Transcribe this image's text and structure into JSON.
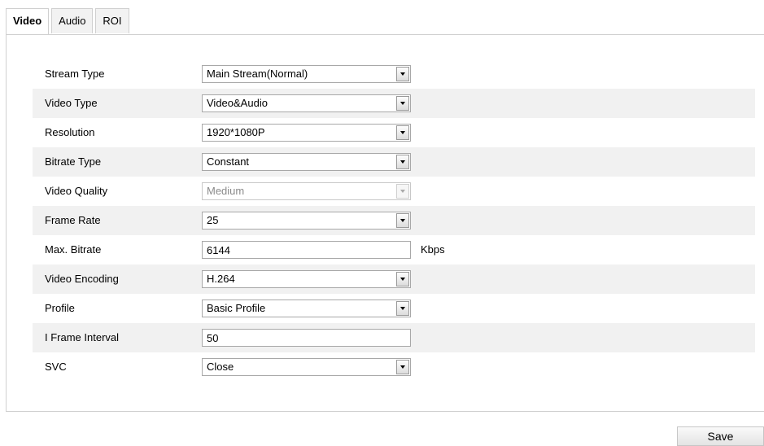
{
  "tabs": [
    {
      "label": "Video",
      "active": true
    },
    {
      "label": "Audio",
      "active": false
    },
    {
      "label": "ROI",
      "active": false
    }
  ],
  "fields": {
    "stream_type": {
      "label": "Stream Type",
      "value": "Main Stream(Normal)"
    },
    "video_type": {
      "label": "Video Type",
      "value": "Video&Audio"
    },
    "resolution": {
      "label": "Resolution",
      "value": "1920*1080P"
    },
    "bitrate_type": {
      "label": "Bitrate Type",
      "value": "Constant"
    },
    "video_quality": {
      "label": "Video Quality",
      "value": "Medium",
      "disabled": true
    },
    "frame_rate": {
      "label": "Frame Rate",
      "value": "25"
    },
    "max_bitrate": {
      "label": "Max. Bitrate",
      "value": "6144",
      "unit": "Kbps"
    },
    "video_encoding": {
      "label": "Video Encoding",
      "value": "H.264"
    },
    "profile": {
      "label": "Profile",
      "value": "Basic Profile"
    },
    "i_frame_interval": {
      "label": "I Frame Interval",
      "value": "50"
    },
    "svc": {
      "label": "SVC",
      "value": "Close"
    }
  },
  "save_label": "Save"
}
